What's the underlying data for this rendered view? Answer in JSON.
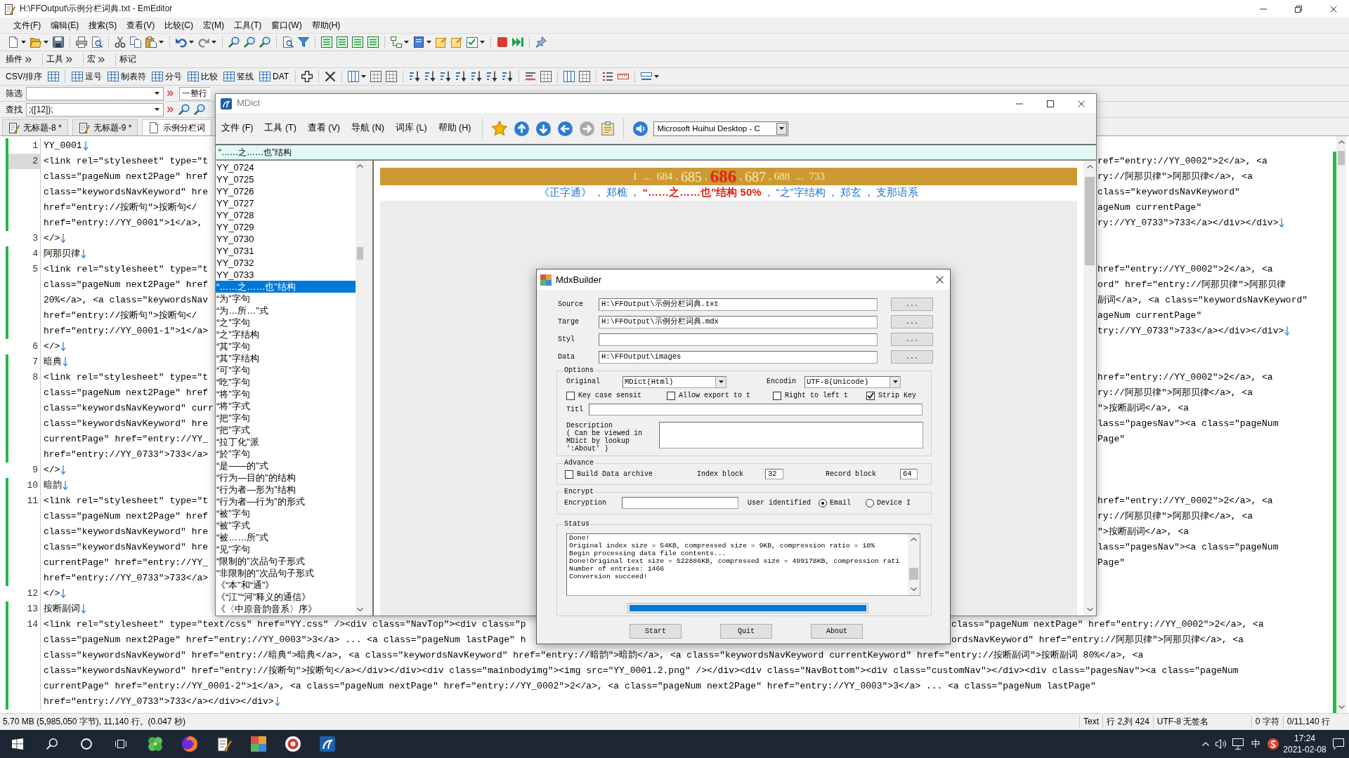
{
  "emeditor": {
    "title": "H:\\FFOutput\\示例分栏词典.txt - EmEditor",
    "menu": [
      "文件(F)",
      "编辑(E)",
      "搜索(S)",
      "查看(V)",
      "比较(C)",
      "宏(M)",
      "工具(T)",
      "窗口(W)",
      "帮助(H)"
    ],
    "toolbar_bands": [
      "插件",
      "工具",
      "宏",
      "标记"
    ],
    "csv_bar": {
      "label": "CSV/排序",
      "modes": [
        "逗号",
        "制表符",
        "分号",
        "比较",
        "竖线",
        "DAT"
      ]
    },
    "filter_bar": {
      "label": "筛选",
      "scope": "一整行"
    },
    "find_bar": {
      "label": "查找",
      "value": ";([12]);"
    },
    "tabs": [
      {
        "label": "无标题-8 *",
        "selected": false
      },
      {
        "label": "无标题-9 *",
        "selected": false
      },
      {
        "label": "示例分栏词",
        "selected": true
      }
    ],
    "editor": {
      "lines": [
        {
          "number": "1",
          "modified": true,
          "current": false,
          "newline_mark": true,
          "rows": [
            {
              "text": "YY_0001"
            }
          ]
        },
        {
          "number": "2",
          "modified": true,
          "current": true,
          "newline_mark": true,
          "rows": [
            {
              "text": "<link rel=\"stylesheet\" type=\"t",
              "tail": "ref=\"entry://YY_0002\">2</a>, <a"
            },
            {
              "text": "class=\"pageNum next2Page\" href",
              "tail": "ry://阿那贝律\">阿那贝律</a>, <a"
            },
            {
              "text": "class=\"keywordsNavKeyword\" hre",
              "tail": "class=\"keywordsNavKeyword\""
            },
            {
              "text": "href=\"entry://按断句\">按断句</",
              "tail": "ageNum currentPage\""
            },
            {
              "text": "href=\"entry://YY_0001\">1</a>,",
              "tail": "ry://YY_0733\">733</a></div></div>"
            }
          ]
        },
        {
          "number": "3",
          "modified": false,
          "current": false,
          "newline_mark": true,
          "rows": [
            {
              "text": "</>"
            }
          ]
        },
        {
          "number": "4",
          "modified": true,
          "current": false,
          "newline_mark": true,
          "rows": [
            {
              "text": "阿那贝律"
            }
          ]
        },
        {
          "number": "5",
          "modified": true,
          "current": false,
          "newline_mark": true,
          "rows": [
            {
              "text": "<link rel=\"stylesheet\" type=\"t",
              "tail": "href=\"entry://YY_0002\">2</a>, <a"
            },
            {
              "text": "class=\"pageNum next2Page\" href",
              "tail": "ord\" href=\"entry://阿那贝律\">阿那贝律"
            },
            {
              "text": "20%</a>, <a class=\"keywordsNav",
              "tail": "副词</a>, <a class=\"keywordsNavKeyword\""
            },
            {
              "text": "href=\"entry://按断句\">按断句</",
              "tail": "ageNum currentPage\""
            },
            {
              "text": "href=\"entry://YY_0001-1\">1</a>",
              "tail": "try://YY_0733\">733</a></div></div>"
            }
          ]
        },
        {
          "number": "6",
          "modified": false,
          "current": false,
          "newline_mark": true,
          "rows": [
            {
              "text": "</>"
            }
          ]
        },
        {
          "number": "7",
          "modified": true,
          "current": false,
          "newline_mark": true,
          "rows": [
            {
              "text": "暗典"
            }
          ]
        },
        {
          "number": "8",
          "modified": true,
          "current": false,
          "newline_mark": false,
          "rows": [
            {
              "text": "<link rel=\"stylesheet\" type=\"t",
              "tail": "href=\"entry://YY_0002\">2</a>, <a"
            },
            {
              "text": "class=\"pageNum next2Page\" href",
              "tail": "ry://阿那贝律\">阿那贝律</a>, <a"
            },
            {
              "text": "class=\"keywordsNavKeyword\" curr",
              "tail": "\">按断副词</a>, <a"
            },
            {
              "text": "class=\"keywordsNavKeyword\" hre",
              "tail": "lass=\"pagesNav\"><a class=\"pageNum"
            },
            {
              "text": "currentPage\" href=\"entry://YY_",
              "tail": "Page\""
            },
            {
              "text": "href=\"entry://YY_0733\">733</a>"
            }
          ]
        },
        {
          "number": "9",
          "modified": false,
          "current": false,
          "newline_mark": true,
          "rows": [
            {
              "text": "</>"
            }
          ]
        },
        {
          "number": "10",
          "modified": true,
          "current": false,
          "newline_mark": true,
          "rows": [
            {
              "text": "暗韵"
            }
          ]
        },
        {
          "number": "11",
          "modified": true,
          "current": false,
          "newline_mark": false,
          "rows": [
            {
              "text": "<link rel=\"stylesheet\" type=\"t",
              "tail": "href=\"entry://YY_0002\">2</a>, <a"
            },
            {
              "text": "class=\"pageNum next2Page\" href",
              "tail": "ry://阿那贝律\">阿那贝律</a>, <a"
            },
            {
              "text": "class=\"keywordsNavKeyword\" hre",
              "tail": "\">按断副词</a>, <a"
            },
            {
              "text": "class=\"keywordsNavKeyword\" hre",
              "tail": "lass=\"pagesNav\"><a class=\"pageNum"
            },
            {
              "text": "currentPage\" href=\"entry://YY_",
              "tail": "Page\""
            },
            {
              "text": "href=\"entry://YY_0733\">733</a>"
            }
          ]
        },
        {
          "number": "12",
          "modified": false,
          "current": false,
          "newline_mark": true,
          "rows": [
            {
              "text": "</>"
            }
          ]
        },
        {
          "number": "13",
          "modified": true,
          "current": false,
          "newline_mark": true,
          "rows": [
            {
              "text": "按断副词"
            }
          ]
        },
        {
          "number": "14",
          "modified": true,
          "current": false,
          "newline_mark": true,
          "rows": [
            {
              "text": "<link rel=\"stylesheet\" type=\"text/css\" href=\"YY.css\" /><div class=\"NavTop\"><div class=\"p",
              "tail": "class=\"pageNum nextPage\" href=\"entry://YY_0002\">2</a>, <a"
            },
            {
              "text": "class=\"pageNum next2Page\" href=\"entry://YY_0003\">3</a> ... <a class=\"pageNum lastPage\" h",
              "tail": "ordsNavKeyword\" href=\"entry://阿那贝律\">阿那贝律</a>, <a"
            },
            {
              "text": "class=\"keywordsNavKeyword\" href=\"entry://暗典\">暗典</a>, <a class=\"keywordsNavKeyword\" href=\"entry://暗韵\">暗韵</a>, <a class=\"keywordsNavKeyword currentKeyword\" href=\"entry://按断副词\">按断副词 80%</a>, <a"
            },
            {
              "text": "class=\"keywordsNavKeyword\" href=\"entry://按断句\">按断句</a></div></div><div class=\"mainbodyimg\"><img src=\"YY_0001.2.png\" /></div><div class=\"NavBottom\"><div class=\"customNav\"></div><div class=\"pagesNav\"><a class=\"pageNum"
            },
            {
              "text": "currentPage\" href=\"entry://YY_0001-2\">1</a>, <a class=\"pageNum nextPage\" href=\"entry://YY_0002\">2</a>, <a class=\"pageNum next2Page\" href=\"entry://YY_0003\">3</a> ... <a class=\"pageNum lastPage\""
            },
            {
              "text": "href=\"entry://YY_0733\">733</a></div></div>"
            }
          ]
        }
      ]
    },
    "status_bar": {
      "summary": "5.70 MB (5,985,050 字节), 11,140 行。(0.047 秒)",
      "fields": [
        "Text",
        "行 2,列 424",
        "UTF-8 无签名",
        "0 字符",
        "0/11,140 行"
      ]
    }
  },
  "mdict": {
    "title": "MDict",
    "menu": [
      "文件 (F)",
      "工具 (T)",
      "查看 (V)",
      "导航 (N)",
      "词库 (L)",
      "帮助 (H)"
    ],
    "forward_enabled": false,
    "voice": "Microsoft Huihui Desktop - C",
    "search": {
      "value": "“……之……也”结构"
    },
    "entries": [
      {
        "label": "YY_0724",
        "selected": false
      },
      {
        "label": "YY_0725",
        "selected": false
      },
      {
        "label": "YY_0726",
        "selected": false
      },
      {
        "label": "YY_0727",
        "selected": false
      },
      {
        "label": "YY_0728",
        "selected": false
      },
      {
        "label": "YY_0729",
        "selected": false
      },
      {
        "label": "YY_0730",
        "selected": false
      },
      {
        "label": "YY_0731",
        "selected": false
      },
      {
        "label": "YY_0732",
        "selected": false
      },
      {
        "label": "YY_0733",
        "selected": false
      },
      {
        "label": "“……之……也”结构",
        "selected": true
      },
      {
        "label": "“为”字句",
        "selected": false
      },
      {
        "label": "“为…所…”式",
        "selected": false
      },
      {
        "label": "“之”字句",
        "selected": false
      },
      {
        "label": "“之”字结构",
        "selected": false
      },
      {
        "label": "“其”字句",
        "selected": false
      },
      {
        "label": "“其”字结构",
        "selected": false
      },
      {
        "label": "“可”字句",
        "selected": false
      },
      {
        "label": "“吃”字句",
        "selected": false
      },
      {
        "label": "“将”字句",
        "selected": false
      },
      {
        "label": "“将”字式",
        "selected": false
      },
      {
        "label": "“把”字句",
        "selected": false
      },
      {
        "label": "“把”字式",
        "selected": false
      },
      {
        "label": "“拉丁化”派",
        "selected": false
      },
      {
        "label": "“於”字句",
        "selected": false
      },
      {
        "label": "“是——的”式",
        "selected": false
      },
      {
        "label": "“行为—目的”的结构",
        "selected": false
      },
      {
        "label": "“行为者—形为”结构",
        "selected": false
      },
      {
        "label": "“行为者—行为”的形式",
        "selected": false
      },
      {
        "label": "“被”字句",
        "selected": false
      },
      {
        "label": "“被”字式",
        "selected": false
      },
      {
        "label": "“被……所”式",
        "selected": false
      },
      {
        "label": "“见”字句",
        "selected": false
      },
      {
        "label": "“限制的”次品句子形式",
        "selected": false
      },
      {
        "label": "“非限制的”次品句子形式",
        "selected": false
      },
      {
        "label": "《“本”和“通”》",
        "selected": false
      },
      {
        "label": "《“江”“河”释义的通信》",
        "selected": false
      },
      {
        "label": "《〈中原音韵音系〉序》",
        "selected": false
      }
    ],
    "pages": [
      {
        "label": "1",
        "selected": false
      },
      {
        "label": "...",
        "selected": false
      },
      {
        "label": "684",
        "separator": ",",
        "selected": false
      },
      {
        "label": "685",
        "separator": ",",
        "selected": false
      },
      {
        "label": "686",
        "separator": ",",
        "selected": true
      },
      {
        "label": "687",
        "separator": ",",
        "selected": false
      },
      {
        "label": "688",
        "selected": false
      },
      {
        "label": "...",
        "selected": false
      },
      {
        "label": "733",
        "selected": false
      }
    ],
    "keywords": [
      {
        "label": "《正字通》",
        "separator": "，",
        "selected": false
      },
      {
        "label": "郑樵",
        "separator": "，",
        "selected": false
      },
      {
        "label": "“……之……也”结构 50%",
        "separator": "，",
        "selected": true
      },
      {
        "label": "“之”字结构",
        "separator": "，",
        "selected": false
      },
      {
        "label": "郑玄",
        "separator": "，",
        "selected": false
      },
      {
        "label": "支那语系",
        "selected": false
      }
    ]
  },
  "mdxbuilder": {
    "title": "MdxBuilder",
    "files": [
      {
        "label": "Source",
        "value": "H:\\FFOutput\\示例分栏词典.txt",
        "button": "..."
      },
      {
        "label": "Targe",
        "value": "H:\\FFOutput\\示例分栏词典.mdx",
        "button": "..."
      },
      {
        "label": "Styl",
        "button": "..."
      },
      {
        "label": "Data",
        "value": "H:\\FFOutput\\images",
        "button": "..."
      }
    ],
    "options": {
      "legend": "Options",
      "original": {
        "label": "Original",
        "value": "MDict(Html)"
      },
      "encoding": {
        "label": "Encodin",
        "value": "UTF-8(Unicode)"
      },
      "flags": [
        {
          "label": "Key case sensit",
          "checked": false
        },
        {
          "label": "Allow export to t",
          "checked": false
        },
        {
          "label": "Right to left t",
          "checked": false
        },
        {
          "label": "Strip Key",
          "checked": true
        }
      ],
      "title_label": "Titl",
      "description_label": [
        "Description",
        "( Can be viewed in",
        "MDict by lookup",
        "':About' )"
      ]
    },
    "advance": {
      "legend": "Advance",
      "archive": {
        "label": "Build Data archive",
        "checked": false
      },
      "index_block": {
        "label": "Index block",
        "value": "32"
      },
      "record_block": {
        "label": "Record block",
        "value": "64"
      }
    },
    "encrypt": {
      "legend": "Encrypt",
      "label": "Encryption",
      "user_label": "User identified",
      "modes": [
        {
          "label": "Email",
          "selected": true
        },
        {
          "label": "Device I",
          "selected": false
        }
      ]
    },
    "status": {
      "legend": "Status",
      "log": [
        "Done!",
        "Original index size = 54KB, compressed size = 9KB, compression ratio = 18%",
        "Begin processing data file contents...",
        "Done!Original text size = 522886KB, compressed size = 499178KB, compression rati",
        "Number of entries: 1466",
        "Conversion succeed!"
      ],
      "level": 1
    },
    "buttons": [
      "Start",
      "Quit",
      "About"
    ]
  },
  "taskbar": {
    "ime": "中",
    "time": "17:24",
    "date": "2021-02-08"
  }
}
